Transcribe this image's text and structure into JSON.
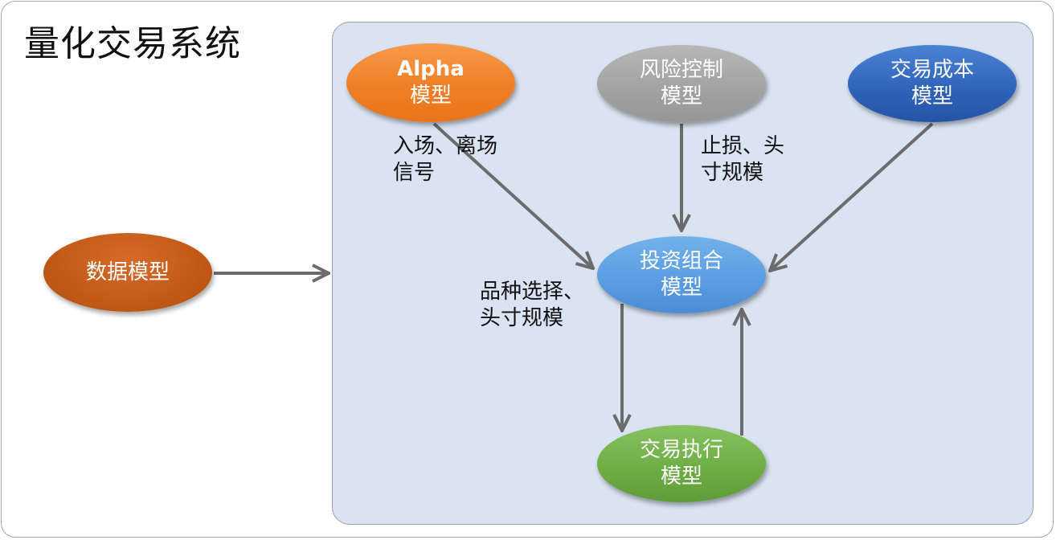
{
  "title": "量化交易系统",
  "nodes": {
    "data": [
      "数据模型"
    ],
    "alpha": [
      "Alpha",
      "模型"
    ],
    "risk": [
      "风险控制",
      "模型"
    ],
    "cost": [
      "交易成本",
      "模型"
    ],
    "portfolio": [
      "投资组合",
      "模型"
    ],
    "execution": [
      "交易执行",
      "模型"
    ]
  },
  "labels": {
    "entry_exit": [
      "入场、离场",
      "信号"
    ],
    "stoploss": [
      "止损、头",
      "寸规模"
    ],
    "selection": [
      "品种选择、",
      "头寸规模"
    ]
  },
  "colors": {
    "arrow": "#6b6b6b",
    "panel": "#dae3f2",
    "data": "#c55a11",
    "alpha": "#ed7d31",
    "risk": "#a5a5a5",
    "cost": "#2f5fb3",
    "portfolio": "#5b9bd5",
    "execution": "#70ad47"
  }
}
